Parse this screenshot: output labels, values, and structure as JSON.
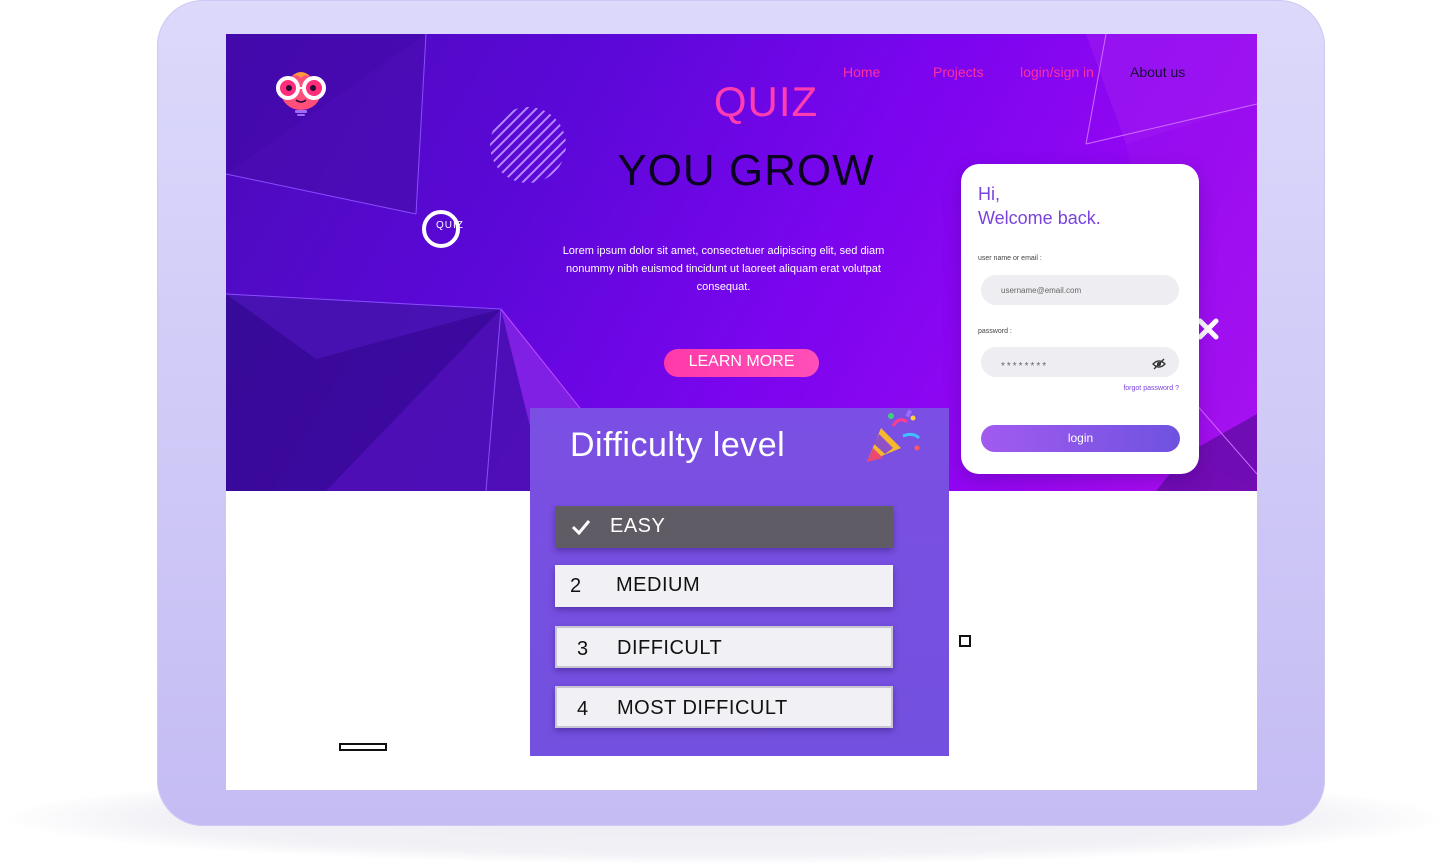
{
  "nav": {
    "items": [
      "Home",
      "Projects",
      "login/sign in",
      "About us"
    ]
  },
  "hero": {
    "quiz_title": "QUIZ",
    "tagline": "YOU GROW",
    "body": "Lorem ipsum dolor sit amet, consectetuer adipiscing elit, sed diam nonummy nibh euismod tincidunt ut laoreet aliquam erat volutpat consequat.",
    "learn_more": "LEARN MORE",
    "brand_mark": "QUIZ"
  },
  "login_card": {
    "greeting": "Hi,",
    "welcome": "Welcome back.",
    "username_label": "user name or email :",
    "username_placeholder": "username@email.com",
    "password_label": "password :",
    "password_mask": "********",
    "forgot": "forgot password ?",
    "login_button": "login"
  },
  "difficulty": {
    "title": "Difficulty level",
    "options": [
      {
        "num": "",
        "label": "EASY",
        "selected": true
      },
      {
        "num": "2",
        "label": "MEDIUM",
        "selected": false
      },
      {
        "num": "3",
        "label": "DIFFICULT",
        "selected": false
      },
      {
        "num": "4",
        "label": "MOST DIFFICULT",
        "selected": false
      }
    ]
  },
  "colors": {
    "accent_pink": "#ff3db0",
    "hero_purple": "#5b08d8",
    "panel_purple": "#7b4fe3",
    "tablet_frame": "#c4bcf3"
  },
  "icons": {
    "logo": "owl-glasses-mascot-icon",
    "close": "close-icon",
    "eye": "eye-hidden-icon",
    "check": "check-icon",
    "party": "party-popper-icon"
  }
}
